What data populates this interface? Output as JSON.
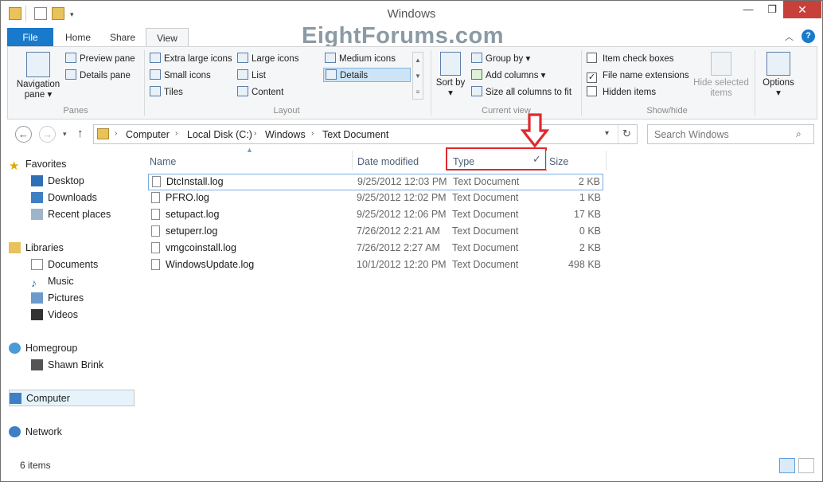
{
  "window": {
    "title": "Windows"
  },
  "watermark": "EightForums.com",
  "tabs": [
    {
      "label": "File"
    },
    {
      "label": "Home"
    },
    {
      "label": "Share"
    },
    {
      "label": "View"
    }
  ],
  "ribbon": {
    "panes": {
      "navigation_pane": "Navigation pane",
      "preview_pane": "Preview pane",
      "details_pane": "Details pane",
      "group_label": "Panes"
    },
    "layout": {
      "extra_large": "Extra large icons",
      "large": "Large icons",
      "medium": "Medium icons",
      "small": "Small icons",
      "list": "List",
      "details": "Details",
      "tiles": "Tiles",
      "content": "Content",
      "group_label": "Layout"
    },
    "current_view": {
      "sort_by": "Sort by",
      "group_by": "Group by",
      "add_columns": "Add columns",
      "size_all": "Size all columns to fit",
      "group_label": "Current view"
    },
    "show_hide": {
      "item_check_boxes": "Item check boxes",
      "file_name_extensions": "File name extensions",
      "hidden_items": "Hidden items",
      "hide_selected": "Hide selected items",
      "group_label": "Show/hide"
    },
    "options": "Options"
  },
  "address": {
    "crumbs": [
      "Computer",
      "Local Disk (C:)",
      "Windows",
      "Text Document"
    ],
    "search_placeholder": "Search Windows"
  },
  "nav": {
    "favorites": "Favorites",
    "desktop": "Desktop",
    "downloads": "Downloads",
    "recent": "Recent places",
    "libraries": "Libraries",
    "documents": "Documents",
    "music": "Music",
    "pictures": "Pictures",
    "videos": "Videos",
    "homegroup": "Homegroup",
    "shawn": "Shawn Brink",
    "computer": "Computer",
    "network": "Network"
  },
  "columns": {
    "name": "Name",
    "date": "Date modified",
    "type": "Type",
    "size": "Size"
  },
  "files": [
    {
      "name": "DtcInstall.log",
      "date": "9/25/2012 12:03 PM",
      "type": "Text Document",
      "size": "2 KB"
    },
    {
      "name": "PFRO.log",
      "date": "9/25/2012 12:02 PM",
      "type": "Text Document",
      "size": "1 KB"
    },
    {
      "name": "setupact.log",
      "date": "9/25/2012 12:06 PM",
      "type": "Text Document",
      "size": "17 KB"
    },
    {
      "name": "setuperr.log",
      "date": "7/26/2012 2:21 AM",
      "type": "Text Document",
      "size": "0 KB"
    },
    {
      "name": "vmgcoinstall.log",
      "date": "7/26/2012 2:27 AM",
      "type": "Text Document",
      "size": "2 KB"
    },
    {
      "name": "WindowsUpdate.log",
      "date": "10/1/2012 12:20 PM",
      "type": "Text Document",
      "size": "498 KB"
    }
  ],
  "status": {
    "items": "6 items"
  },
  "colors": {
    "accent": "#1979ca",
    "highlight_red": "#e0292f",
    "close": "#c7403a"
  }
}
